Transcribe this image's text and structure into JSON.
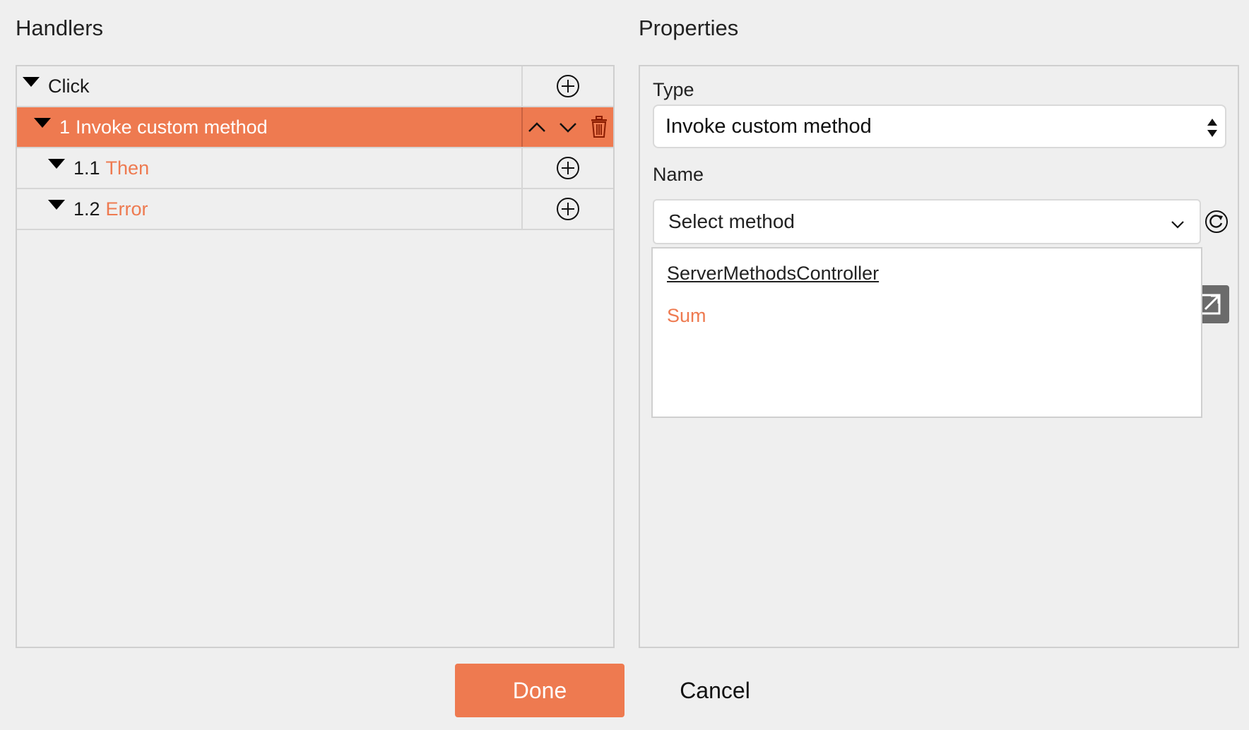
{
  "handlers": {
    "title": "Handlers",
    "rows": [
      {
        "label": "Click",
        "num": "",
        "level": 0,
        "selected": false
      },
      {
        "label": "Invoke custom method",
        "num": "1",
        "level": 1,
        "selected": true
      },
      {
        "label": "Then",
        "num": "1.1",
        "level": 2,
        "selected": false
      },
      {
        "label": "Error",
        "num": "1.2",
        "level": 2,
        "selected": false
      }
    ]
  },
  "properties": {
    "title": "Properties",
    "type_label": "Type",
    "type_value": "Invoke custom method",
    "name_label": "Name",
    "name_placeholder": "Select method",
    "dropdown": [
      {
        "label": "ServerMethodsController"
      },
      {
        "label": "Sum"
      }
    ]
  },
  "footer": {
    "done_label": "Done",
    "cancel_label": "Cancel"
  },
  "colors": {
    "accent": "#ee7a50",
    "background": "#efefef"
  }
}
